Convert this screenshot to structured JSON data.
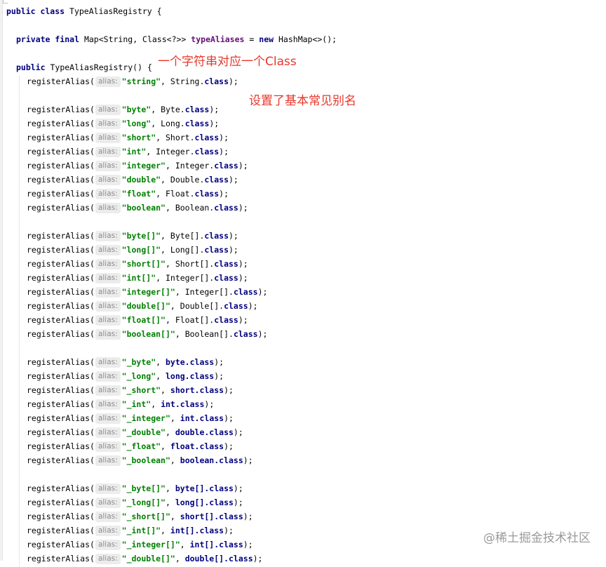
{
  "editor": {
    "class_decl": {
      "kw": "public class",
      "name": "TypeAliasRegistry {"
    },
    "field_decl": {
      "kw": "private final",
      "type": "Map<String, Class<?>>",
      "name": "typeAliases",
      "eq": "=",
      "new_kw": "new",
      "init": "HashMap<>();"
    },
    "ctor_decl": {
      "kw": "public",
      "sig": "TypeAliasRegistry() {"
    },
    "method": "registerAlias(",
    "hint": "alias:",
    "class_kw": "class",
    "close": ");",
    "lines": [
      {
        "alias": "\"string\"",
        "type": "String.",
        "primitive": false
      },
      null,
      {
        "alias": "\"byte\"",
        "type": "Byte.",
        "primitive": false
      },
      {
        "alias": "\"long\"",
        "type": "Long.",
        "primitive": false
      },
      {
        "alias": "\"short\"",
        "type": "Short.",
        "primitive": false
      },
      {
        "alias": "\"int\"",
        "type": "Integer.",
        "primitive": false
      },
      {
        "alias": "\"integer\"",
        "type": "Integer.",
        "primitive": false
      },
      {
        "alias": "\"double\"",
        "type": "Double.",
        "primitive": false
      },
      {
        "alias": "\"float\"",
        "type": "Float.",
        "primitive": false
      },
      {
        "alias": "\"boolean\"",
        "type": "Boolean.",
        "primitive": false
      },
      null,
      {
        "alias": "\"byte[]\"",
        "type": "Byte[].",
        "primitive": false
      },
      {
        "alias": "\"long[]\"",
        "type": "Long[].",
        "primitive": false
      },
      {
        "alias": "\"short[]\"",
        "type": "Short[].",
        "primitive": false
      },
      {
        "alias": "\"int[]\"",
        "type": "Integer[].",
        "primitive": false
      },
      {
        "alias": "\"integer[]\"",
        "type": "Integer[].",
        "primitive": false
      },
      {
        "alias": "\"double[]\"",
        "type": "Double[].",
        "primitive": false
      },
      {
        "alias": "\"float[]\"",
        "type": "Float[].",
        "primitive": false
      },
      {
        "alias": "\"boolean[]\"",
        "type": "Boolean[].",
        "primitive": false
      },
      null,
      {
        "alias": "\"_byte\"",
        "type": "byte.",
        "primitive": true
      },
      {
        "alias": "\"_long\"",
        "type": "long.",
        "primitive": true
      },
      {
        "alias": "\"_short\"",
        "type": "short.",
        "primitive": true
      },
      {
        "alias": "\"_int\"",
        "type": "int.",
        "primitive": true
      },
      {
        "alias": "\"_integer\"",
        "type": "int.",
        "primitive": true
      },
      {
        "alias": "\"_double\"",
        "type": "double.",
        "primitive": true
      },
      {
        "alias": "\"_float\"",
        "type": "float.",
        "primitive": true
      },
      {
        "alias": "\"_boolean\"",
        "type": "boolean.",
        "primitive": true
      },
      null,
      {
        "alias": "\"_byte[]\"",
        "type": "byte[].",
        "primitive": true
      },
      {
        "alias": "\"_long[]\"",
        "type": "long[].",
        "primitive": true
      },
      {
        "alias": "\"_short[]\"",
        "type": "short[].",
        "primitive": true
      },
      {
        "alias": "\"_int[]\"",
        "type": "int[].",
        "primitive": true
      },
      {
        "alias": "\"_integer[]\"",
        "type": "int[].",
        "primitive": true
      },
      {
        "alias": "\"_double[]\"",
        "type": "double[].",
        "primitive": true
      }
    ]
  },
  "annotations": {
    "note1": "一个字符串对应一个Class",
    "note2": "设置了基本常见别名"
  },
  "watermark": "@稀土掘金技术社区",
  "colors": {
    "keyword": "#000080",
    "field": "#660e7a",
    "string": "#008000",
    "hint_bg": "#ececec",
    "annotation": "#e8362b"
  }
}
